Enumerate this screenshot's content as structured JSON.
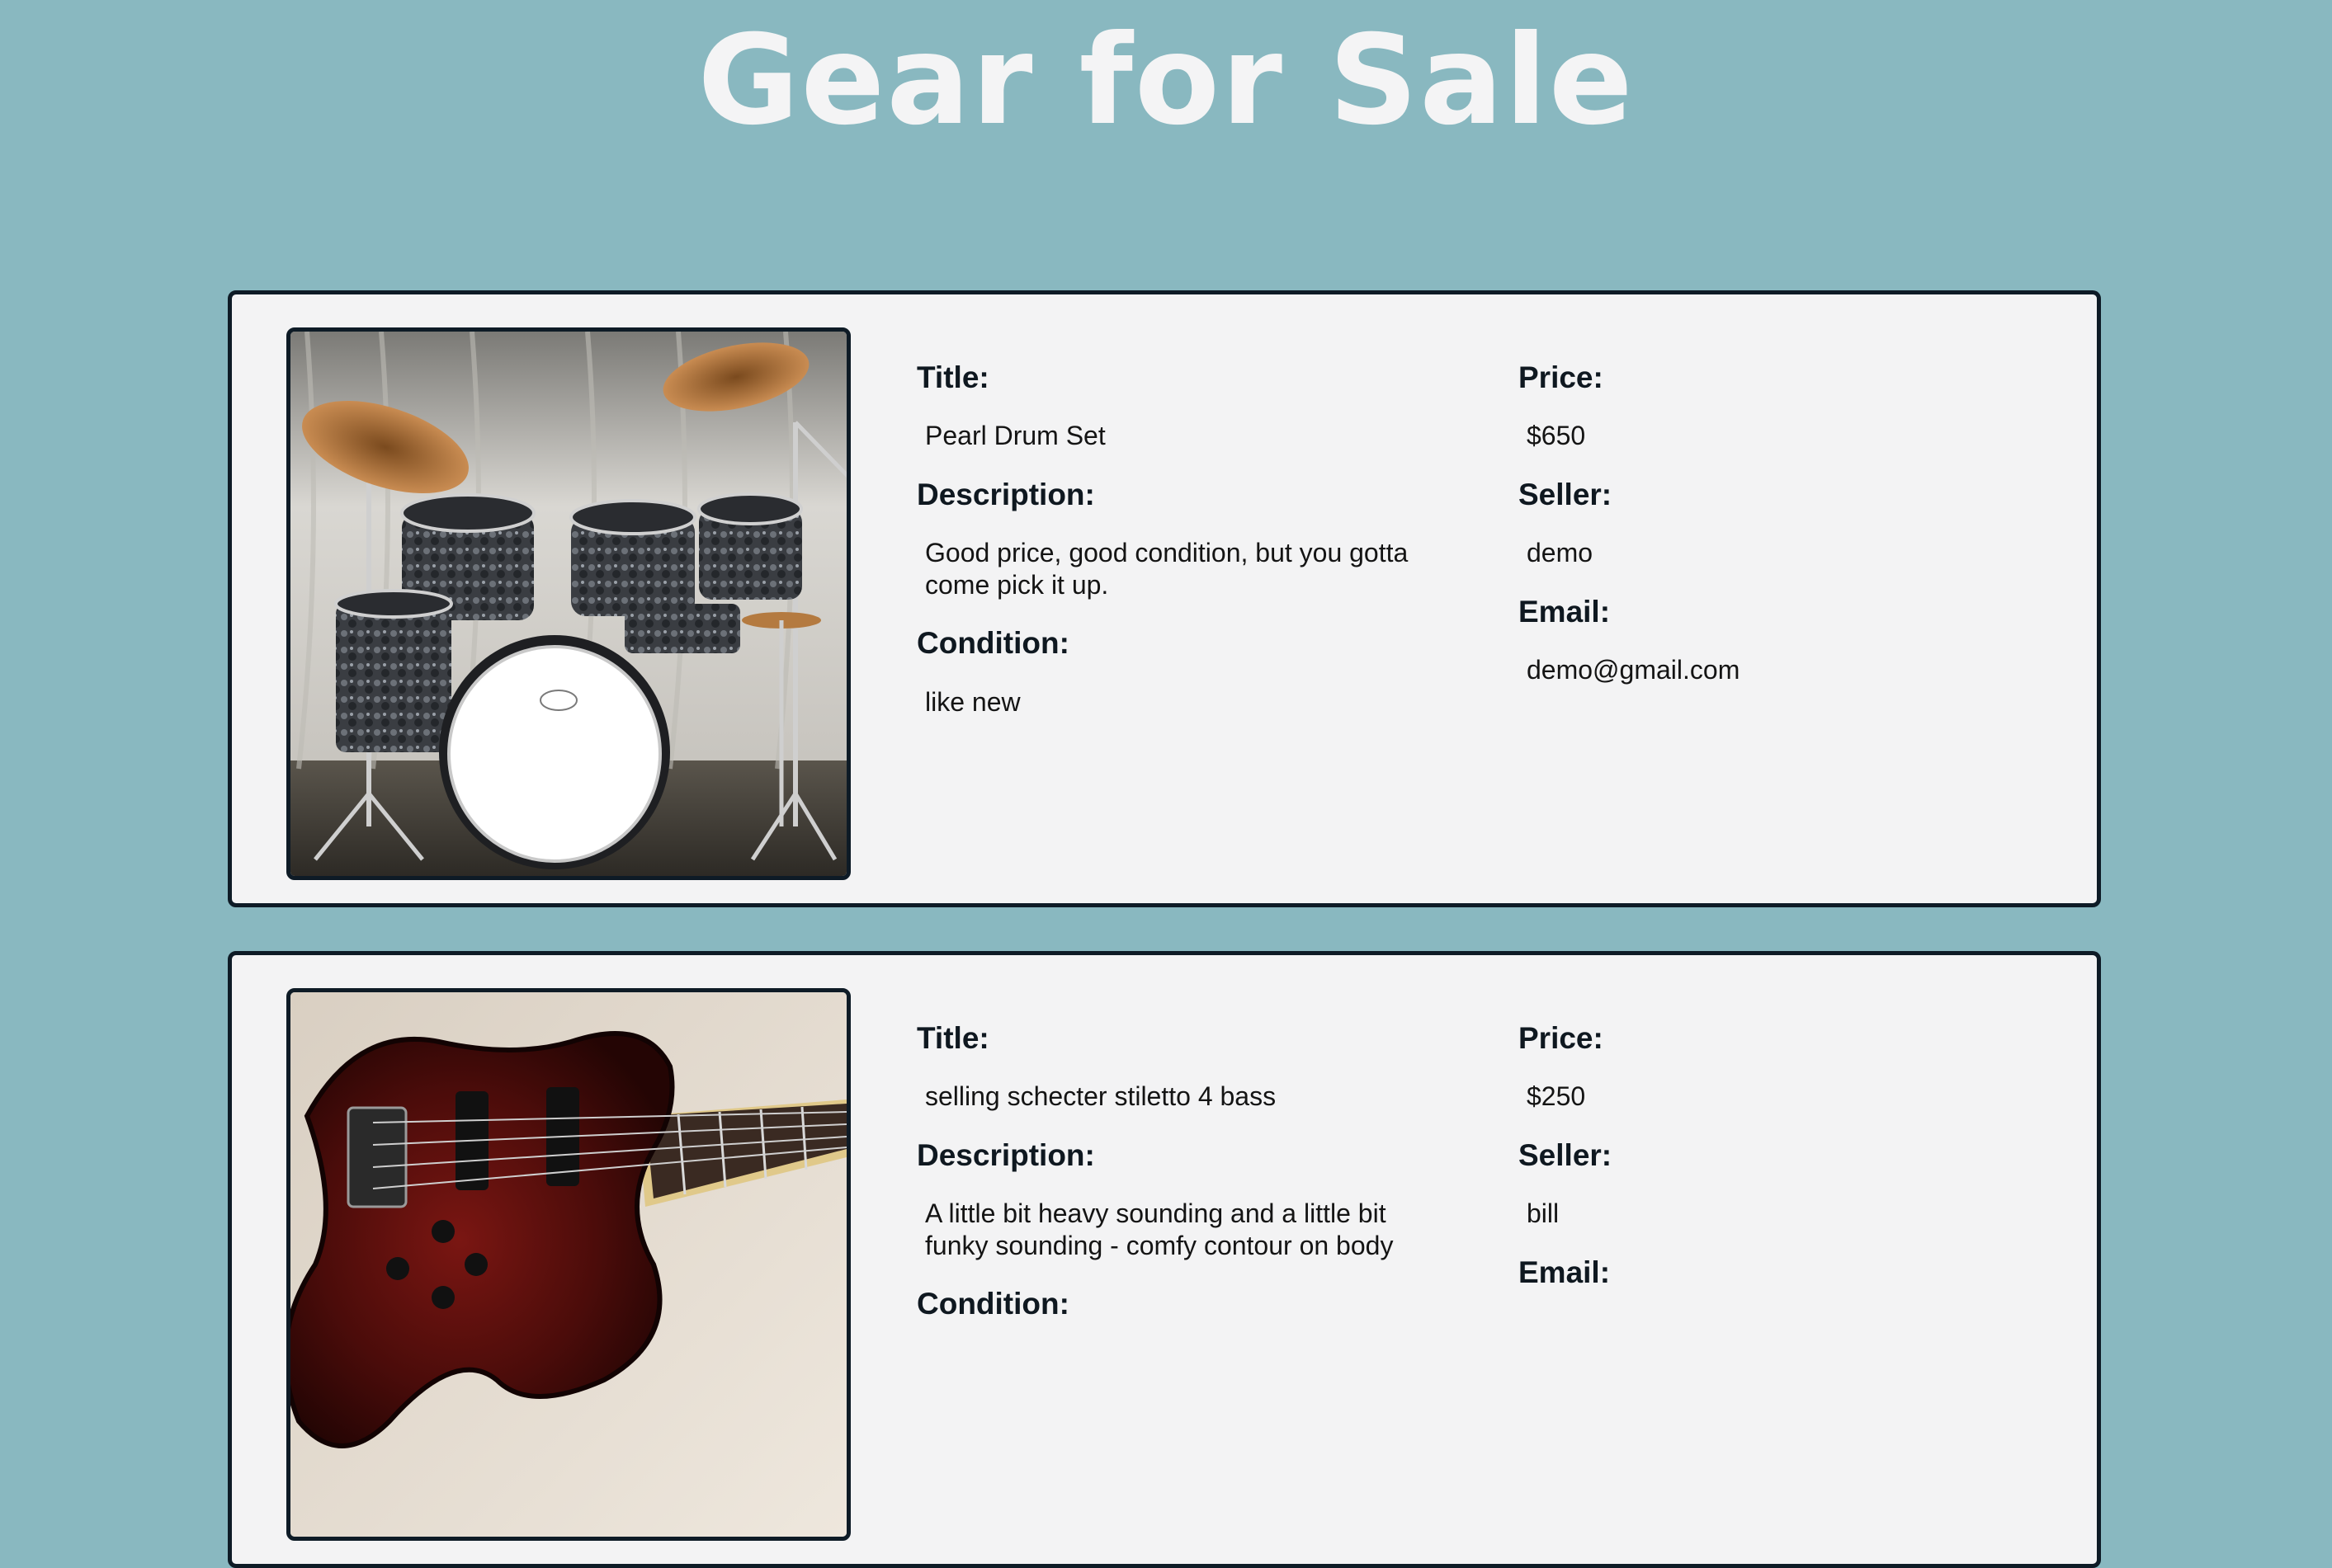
{
  "page": {
    "title": "Gear for Sale"
  },
  "colors": {
    "background": "#89b8c0",
    "card_background": "#f3f3f4",
    "card_border": "#0e1b26",
    "title_text": "#f4f4f5"
  },
  "labels": {
    "title": "Title:",
    "description": "Description:",
    "condition": "Condition:",
    "price": "Price:",
    "seller": "Seller:",
    "email": "Email:"
  },
  "listings": [
    {
      "image_icon": "drum-kit-photo",
      "title": "Pearl Drum Set",
      "description": "Good price, good condition, but you gotta come pick it up.",
      "condition": "like new",
      "price": "$650",
      "seller": "demo",
      "email": "demo@gmail.com"
    },
    {
      "image_icon": "bass-guitar-photo",
      "title": "selling schecter stiletto 4 bass",
      "description": "A little bit heavy sounding and a little bit funky sounding - comfy contour on body",
      "condition": "",
      "price": "$250",
      "seller": "bill",
      "email": ""
    }
  ]
}
